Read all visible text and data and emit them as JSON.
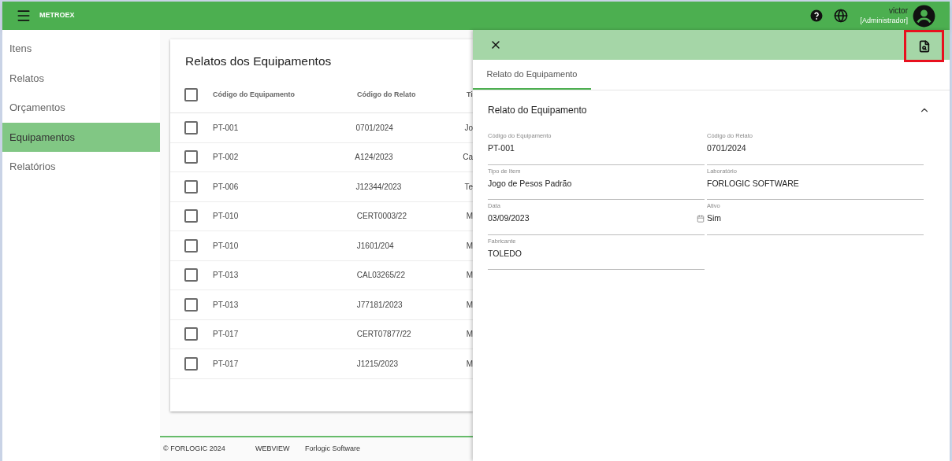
{
  "app_bar": {
    "brand": "METROEX",
    "user": {
      "name": "victor",
      "role": "[Administrador]"
    }
  },
  "sidebar": {
    "items": [
      {
        "label": "Itens",
        "selected": false
      },
      {
        "label": "Relatos",
        "selected": false
      },
      {
        "label": "Orçamentos",
        "selected": false
      },
      {
        "label": "Equipamentos",
        "selected": true
      },
      {
        "label": "Relatórios",
        "selected": false
      }
    ]
  },
  "table": {
    "title": "Relatos dos Equipamentos",
    "all_checked": false,
    "columns": [
      "Código do Equipamento",
      "Código do Relato",
      "Ti"
    ],
    "rows": [
      {
        "checked": false,
        "cells": [
          "PT-001",
          "0701/2024",
          "Jo"
        ]
      },
      {
        "checked": false,
        "cells": [
          "PT-002",
          "A124/2023",
          "Ca"
        ]
      },
      {
        "checked": false,
        "cells": [
          "PT-006",
          "J12344/2023",
          "Te"
        ]
      },
      {
        "checked": false,
        "cells": [
          "PT-010",
          "CERT0003/22",
          "M"
        ]
      },
      {
        "checked": false,
        "cells": [
          "PT-010",
          "J1601/204",
          "M"
        ]
      },
      {
        "checked": false,
        "cells": [
          "PT-013",
          "CAL03265/22",
          "M"
        ]
      },
      {
        "checked": false,
        "cells": [
          "PT-013",
          "J77181/2023",
          "M"
        ]
      },
      {
        "checked": false,
        "cells": [
          "PT-017",
          "CERT07877/22",
          "M"
        ]
      },
      {
        "checked": false,
        "cells": [
          "PT-017",
          "J1215/2023",
          "M"
        ]
      }
    ]
  },
  "footer": [
    "© FORLOGIC 2024",
    "WEBVIEW",
    "Forlogic Software"
  ],
  "drawer": {
    "tabs": [
      {
        "label": "Relato do Equipamento",
        "selected": true
      }
    ],
    "section": {
      "title": "Relato do Equipamento",
      "expanded": true,
      "fields": [
        {
          "kind": "text",
          "label": "Código do Equipamento",
          "value": "PT-001"
        },
        {
          "kind": "text",
          "label": "Código do Relato",
          "value": "0701/2024"
        },
        {
          "kind": "text",
          "label": "Tipo de Item",
          "value": "Jogo de Pesos Padrão"
        },
        {
          "kind": "text",
          "label": "Laboratório",
          "value": "FORLOGIC SOFTWARE"
        },
        {
          "kind": "date",
          "label": "Data",
          "value": "03/09/2023"
        },
        {
          "kind": "text",
          "label": "Ativo",
          "value": "Sim"
        },
        {
          "kind": "text",
          "label": "Fabricante",
          "value": "TOLEDO"
        }
      ]
    }
  }
}
